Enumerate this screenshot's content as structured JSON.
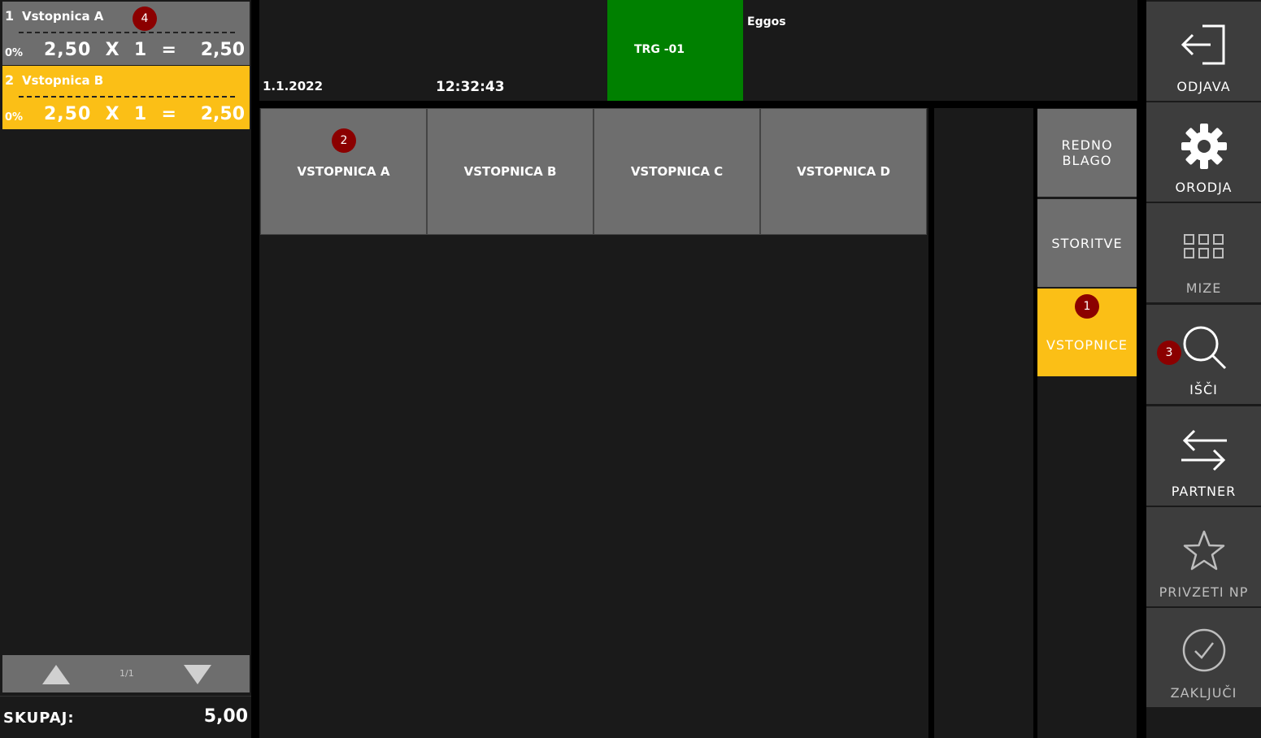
{
  "receipt": {
    "lines": [
      {
        "num": "1",
        "name": "Vstopnica A",
        "discount": "0%",
        "calc": "2,50  X  1  =",
        "total": "2,50",
        "style": "grey"
      },
      {
        "num": "2",
        "name": "Vstopnica B",
        "discount": "0%",
        "calc": "2,50  X  1  =",
        "total": "2,50",
        "style": "yellow"
      }
    ],
    "page_indicator": "1/1",
    "total_label": "SKUPAJ:",
    "total_value": "5,00"
  },
  "header": {
    "date": "1.1.2022",
    "time": "12:32:43",
    "register": "TRG -01",
    "user": "Eggos"
  },
  "products": [
    "VSTOPNICA A",
    "VSTOPNICA B",
    "VSTOPNICA C",
    "VSTOPNICA D"
  ],
  "categories": [
    {
      "label": "REDNO BLAGO",
      "style": "grey"
    },
    {
      "label": "STORITVE",
      "style": "grey"
    },
    {
      "label": "VSTOPNICE",
      "style": "yellow"
    }
  ],
  "actions": [
    {
      "label": "ODJAVA",
      "icon": "logout-icon"
    },
    {
      "label": "ORODJA",
      "icon": "gear-icon"
    },
    {
      "label": "MIZE",
      "icon": "grid-icon"
    },
    {
      "label": "IŠČI",
      "icon": "search-icon"
    },
    {
      "label": "PARTNER",
      "icon": "swap-arrows-icon"
    },
    {
      "label": "PRIVZETI NP",
      "icon": "star-icon"
    },
    {
      "label": "ZAKLJUČI",
      "icon": "check-circle-icon"
    }
  ],
  "markers": [
    "1",
    "2",
    "3",
    "4"
  ],
  "colors": {
    "accent_yellow": "#fbbf16",
    "register_green": "#008000",
    "marker_red": "#8b0000",
    "tile_grey": "#6e6e6e"
  }
}
